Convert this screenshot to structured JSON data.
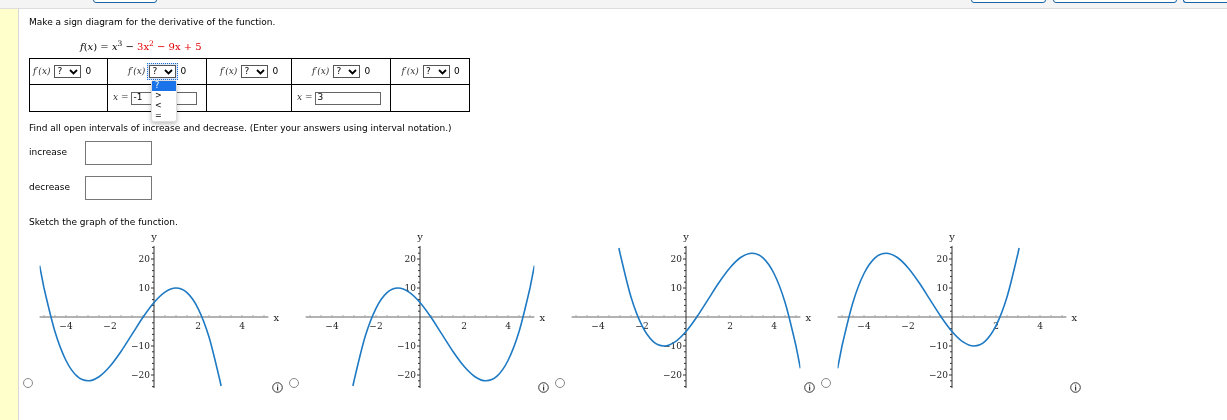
{
  "question": {
    "instruction": "Make a sign diagram for the derivative of the function.",
    "formula": [
      {
        "text": "*f*(*x*) = *x*$^{3}$ − ",
        "highlighted": false
      },
      {
        "text": "3x$^{2}$ − 9x + 5",
        "highlighted": true
      }
    ]
  },
  "sign_table": {
    "top_row": [
      {
        "function_label": "f′(x)",
        "relation": "?",
        "rhs": "0",
        "focused": false
      },
      {
        "function_label": "f′(x)",
        "relation": "?",
        "rhs": "0",
        "focused": true
      },
      {
        "function_label": "f′(x)",
        "relation": "?",
        "rhs": "0",
        "focused": false
      },
      {
        "function_label": "f′(x)",
        "relation": "?",
        "rhs": "0",
        "focused": false
      },
      {
        "function_label": "f′(x)",
        "relation": "?",
        "rhs": "0",
        "focused": false
      }
    ],
    "bottom_row": [
      {
        "kind": "empty"
      },
      {
        "kind": "input",
        "label": "x =",
        "value": "-1"
      },
      {
        "kind": "empty"
      },
      {
        "kind": "input",
        "label": "x =",
        "value": "3"
      },
      {
        "kind": "empty"
      }
    ]
  },
  "dropdown": {
    "options": [
      {
        "label": "?",
        "selected": true
      },
      {
        "label": ">",
        "selected": false
      },
      {
        "label": "<",
        "selected": false
      },
      {
        "label": "=",
        "selected": false
      }
    ]
  },
  "intervals": {
    "prompt": "Find all open intervals of increase and decrease. (Enter your answers using interval notation.)",
    "fields": [
      {
        "label": "increase"
      },
      {
        "label": "decrease"
      }
    ]
  },
  "sketch": {
    "prompt": "Sketch the graph of the function.",
    "options": [
      {
        "checked": false,
        "chart_data": {
          "type": "line",
          "xlabel": "x",
          "ylabel": "y",
          "xlim": [
            -5.2,
            5.2
          ],
          "ylim": [
            -24.5,
            24.5
          ],
          "xticks": [
            -4,
            -2,
            2,
            4
          ],
          "yticks": [
            -20,
            -10,
            10,
            20
          ],
          "x": [
            -5.2,
            -5,
            -4.5,
            -4,
            -3.5,
            -3,
            -2.5,
            -2,
            -1.5,
            -1,
            -0.5,
            0,
            0.5,
            1,
            1.5,
            2,
            2.5,
            3,
            3.05
          ],
          "series": [
            {
              "color": "#1f7ac4",
              "values": [
                17.7,
                10,
                -5.1,
                -15,
                -20.4,
                -22,
                -20.6,
                -17,
                -11.9,
                -6,
                -0.1,
                5,
                8.6,
                10,
                8.4,
                3,
                -6.9,
                -22,
                -23.8
              ]
            }
          ]
        }
      },
      {
        "checked": false,
        "chart_data": {
          "type": "line",
          "xlabel": "x",
          "ylabel": "y",
          "xlim": [
            -5.2,
            5.2
          ],
          "ylim": [
            -24.5,
            24.5
          ],
          "xticks": [
            -4,
            -2,
            2,
            4
          ],
          "yticks": [
            -20,
            -10,
            10,
            20
          ],
          "x": [
            -3.05,
            -3,
            -2.5,
            -2,
            -1.5,
            -1,
            -0.5,
            0,
            0.5,
            1,
            1.5,
            2,
            2.5,
            3,
            3.5,
            4,
            4.5,
            5,
            5.2
          ],
          "series": [
            {
              "color": "#1f7ac4",
              "values": [
                -23.8,
                -22,
                -6.9,
                3,
                8.4,
                10,
                8.6,
                5,
                -0.1,
                -6,
                -11.9,
                -17,
                -20.6,
                -22,
                -20.4,
                -15,
                -5.1,
                10,
                17.7
              ]
            }
          ]
        }
      },
      {
        "checked": false,
        "chart_data": {
          "type": "line",
          "xlabel": "x",
          "ylabel": "y",
          "xlim": [
            -5.2,
            5.2
          ],
          "ylim": [
            -24.5,
            24.5
          ],
          "xticks": [
            -4,
            -2,
            2,
            4
          ],
          "yticks": [
            -20,
            -10,
            10,
            20
          ],
          "x": [
            -3.05,
            -3,
            -2.5,
            -2,
            -1.5,
            -1,
            -0.5,
            0,
            0.5,
            1,
            1.5,
            2,
            2.5,
            3,
            3.5,
            4,
            4.5,
            5,
            5.2
          ],
          "series": [
            {
              "color": "#1f7ac4",
              "values": [
                23.8,
                22,
                6.9,
                -3,
                -8.4,
                -10,
                -8.6,
                -5,
                0.1,
                6,
                11.9,
                17,
                20.6,
                22,
                20.4,
                15,
                5.1,
                -10,
                -17.7
              ]
            }
          ]
        }
      },
      {
        "checked": false,
        "chart_data": {
          "type": "line",
          "xlabel": "x",
          "ylabel": "y",
          "xlim": [
            -5.2,
            5.2
          ],
          "ylim": [
            -24.5,
            24.5
          ],
          "xticks": [
            -4,
            -2,
            2,
            4
          ],
          "yticks": [
            -20,
            -10,
            10,
            20
          ],
          "x": [
            -5.2,
            -5,
            -4.5,
            -4,
            -3.5,
            -3,
            -2.5,
            -2,
            -1.5,
            -1,
            -0.5,
            0,
            0.5,
            1,
            1.5,
            2,
            2.5,
            3,
            3.05
          ],
          "series": [
            {
              "color": "#1f7ac4",
              "values": [
                -17.7,
                -10,
                5.1,
                15,
                20.4,
                22,
                20.6,
                17,
                11.9,
                6,
                0.1,
                -5,
                -8.6,
                -10,
                -8.4,
                -3,
                6.9,
                22,
                23.8
              ]
            }
          ]
        }
      }
    ]
  }
}
